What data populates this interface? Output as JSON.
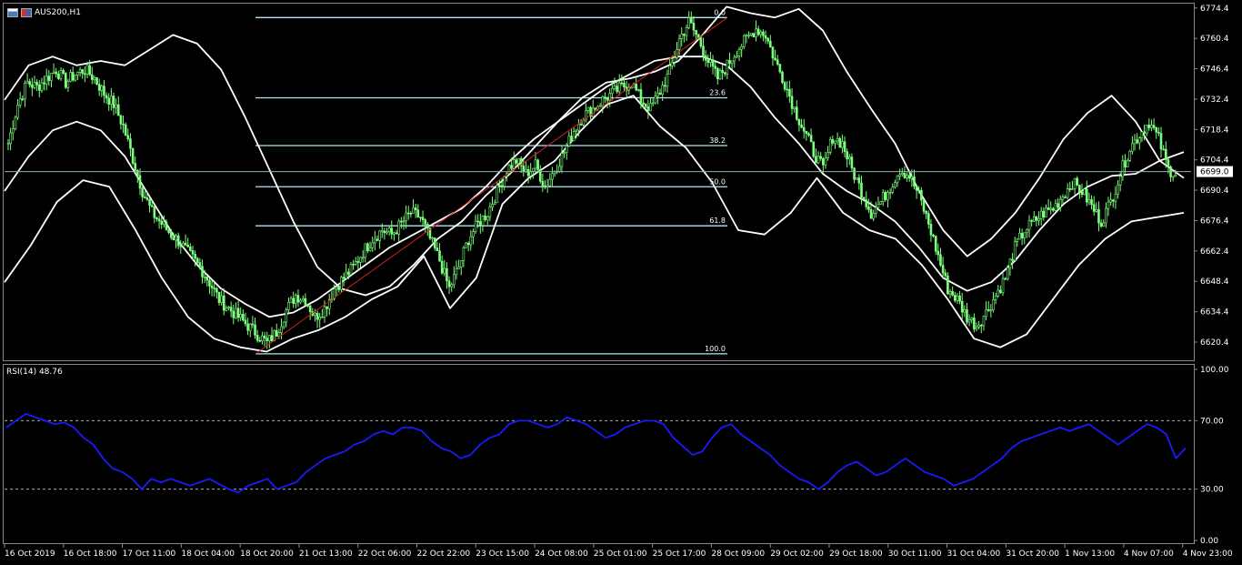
{
  "chart_data": [
    {
      "type": "candlestick",
      "title": "AUS200,H1",
      "ylim": [
        6612,
        6776
      ],
      "y_ticks": [
        "6774.4",
        "6760.4",
        "6746.4",
        "6732.4",
        "6718.4",
        "6704.4",
        "6690.4",
        "6676.4",
        "6662.4",
        "6648.4",
        "6634.4",
        "6620.4"
      ],
      "x_ticks": [
        "16 Oct 2019",
        "16 Oct 18:00",
        "17 Oct 11:00",
        "18 Oct 04:00",
        "18 Oct 20:00",
        "21 Oct 13:00",
        "22 Oct 06:00",
        "22 Oct 22:00",
        "23 Oct 15:00",
        "24 Oct 08:00",
        "25 Oct 01:00",
        "25 Oct 17:00",
        "28 Oct 09:00",
        "29 Oct 02:00",
        "29 Oct 18:00",
        "30 Oct 11:00",
        "31 Oct 04:00",
        "31 Oct 20:00",
        "1 Nov 13:00",
        "4 Nov 07:00",
        "4 Nov 23:00"
      ],
      "current_price": "6699.0",
      "close_path": [
        6712,
        6730,
        6740,
        6738,
        6742,
        6746,
        6740,
        6744,
        6746,
        6742,
        6735,
        6730,
        6720,
        6705,
        6690,
        6680,
        6675,
        6670,
        6666,
        6660,
        6655,
        6648,
        6640,
        6636,
        6632,
        6628,
        6624,
        6620,
        6625,
        6635,
        6642,
        6640,
        6632,
        6636,
        6645,
        6650,
        6655,
        6662,
        6668,
        6672,
        6670,
        6675,
        6680,
        6678,
        6668,
        6658,
        6645,
        6655,
        6668,
        6675,
        6680,
        6690,
        6700,
        6704,
        6698,
        6702,
        6692,
        6700,
        6708,
        6718,
        6725,
        6728,
        6732,
        6735,
        6738,
        6740,
        6732,
        6728,
        6736,
        6745,
        6760,
        6768,
        6760,
        6750,
        6742,
        6748,
        6755,
        6760,
        6765,
        6762,
        6750,
        6740,
        6728,
        6718,
        6708,
        6700,
        6715,
        6712,
        6700,
        6690,
        6680,
        6685,
        6692,
        6700,
        6697,
        6688,
        6675,
        6660,
        6645,
        6640,
        6632,
        6628,
        6634,
        6642,
        6650,
        6664,
        6672,
        6676,
        6680,
        6682,
        6688,
        6694,
        6690,
        6683,
        6676,
        6685,
        6698,
        6710,
        6716,
        6722,
        6714,
        6700,
        6698
      ],
      "bollinger": {
        "upper": [
          6732,
          6748,
          6752,
          6748,
          6750,
          6748,
          6755,
          6762,
          6758,
          6746,
          6724,
          6700,
          6676,
          6655,
          6645,
          6642,
          6646,
          6656,
          6668,
          6676,
          6688,
          6698,
          6710,
          6722,
          6733,
          6740,
          6742,
          6745,
          6750,
          6762,
          6775,
          6772,
          6770,
          6774,
          6764,
          6745,
          6728,
          6712,
          6690,
          6672,
          6660,
          6668,
          6680,
          6696,
          6714,
          6726,
          6734,
          6722,
          6704,
          6696
        ],
        "middle": [
          6690,
          6706,
          6718,
          6722,
          6718,
          6706,
          6688,
          6670,
          6656,
          6645,
          6638,
          6632,
          6634,
          6640,
          6648,
          6656,
          6664,
          6670,
          6676,
          6682,
          6692,
          6704,
          6714,
          6722,
          6730,
          6738,
          6744,
          6750,
          6752,
          6752,
          6748,
          6738,
          6724,
          6712,
          6698,
          6690,
          6684,
          6676,
          6664,
          6650,
          6644,
          6648,
          6658,
          6672,
          6684,
          6692,
          6697,
          6698,
          6704,
          6708
        ],
        "lower": [
          6648,
          6665,
          6685,
          6695,
          6692,
          6672,
          6650,
          6632,
          6622,
          6618,
          6616,
          6622,
          6626,
          6632,
          6640,
          6646,
          6660,
          6636,
          6650,
          6684,
          6696,
          6704,
          6718,
          6730,
          6734,
          6720,
          6710,
          6694,
          6672,
          6670,
          6680,
          6696,
          6680,
          6672,
          6668,
          6656,
          6640,
          6622,
          6618,
          6624,
          6640,
          6656,
          6668,
          6676,
          6678,
          6680
        ]
      },
      "fibonacci": {
        "high": 6770,
        "low": 6615,
        "levels": [
          {
            "label": "0.0",
            "value": 6770
          },
          {
            "label": "23.6",
            "value": 6733
          },
          {
            "label": "38.2",
            "value": 6711
          },
          {
            "label": "50.0",
            "value": 6692
          },
          {
            "label": "61.8",
            "value": 6674
          },
          {
            "label": "100.0",
            "value": 6615
          }
        ]
      },
      "colors": {
        "candle": "#7cff7c",
        "band": "#ffffff",
        "fib": "#aee7f2",
        "trend": "#d22020",
        "grid_line": "#8fb0b0"
      }
    },
    {
      "type": "line",
      "title": "RSI(14) 48.76",
      "ylim": [
        0,
        100
      ],
      "y_ticks": [
        "100.00",
        "70.00",
        "30.00",
        "0.00"
      ],
      "levels": [
        70,
        30
      ],
      "series": [
        {
          "values": [
            66,
            70,
            74,
            72,
            70,
            68,
            69,
            66,
            60,
            56,
            48,
            42,
            40,
            36,
            30,
            36,
            34,
            36,
            34,
            32,
            34,
            36,
            33,
            30,
            28,
            32,
            34,
            36,
            30,
            32,
            34,
            40,
            44,
            48,
            50,
            52,
            56,
            58,
            62,
            64,
            62,
            66,
            66,
            64,
            58,
            54,
            52,
            48,
            50,
            56,
            60,
            62,
            68,
            70,
            70,
            68,
            66,
            68,
            72,
            70,
            68,
            64,
            60,
            62,
            66,
            68,
            70,
            70,
            68,
            60,
            55,
            50,
            52,
            60,
            66,
            68,
            62,
            58,
            54,
            50,
            44,
            40,
            36,
            34,
            30,
            34,
            40,
            44,
            46,
            42,
            38,
            40,
            44,
            48,
            44,
            40,
            38,
            36,
            32,
            34,
            36,
            40,
            44,
            48,
            54,
            58,
            60,
            62,
            64,
            66,
            64,
            66,
            68,
            64,
            60,
            56,
            60,
            64,
            68,
            66,
            62,
            48,
            54
          ]
        }
      ],
      "colors": {
        "line": "#1a1aff"
      }
    }
  ]
}
